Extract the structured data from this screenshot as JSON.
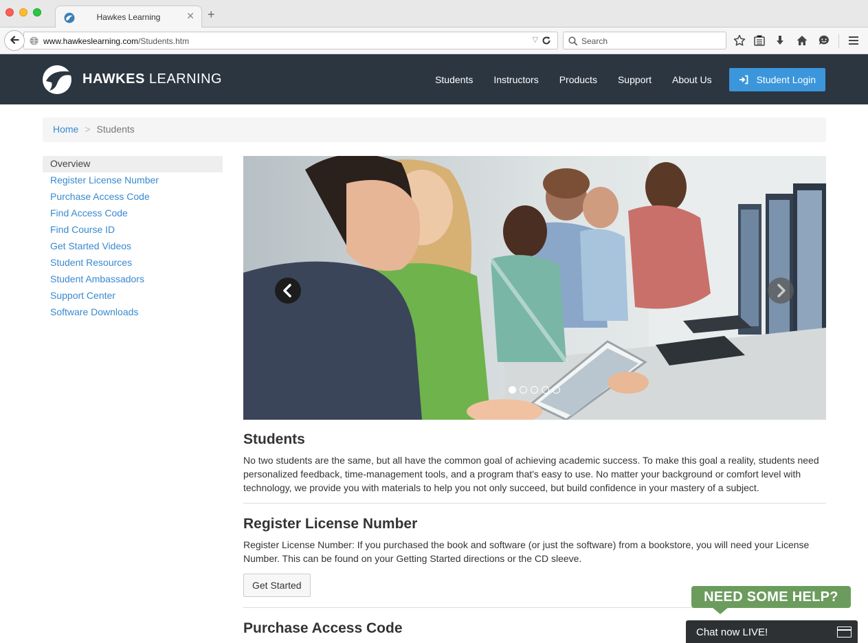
{
  "browser": {
    "tab_title": "Hawkes Learning",
    "url_host": "www.hawkeslearning.com",
    "url_path": "/Students.htm",
    "search_placeholder": "Search"
  },
  "site": {
    "logo_bold": "HAWKES",
    "logo_light": "LEARNING",
    "nav": [
      "Students",
      "Instructors",
      "Products",
      "Support",
      "About Us"
    ],
    "login_label": "Student Login"
  },
  "breadcrumb": {
    "home": "Home",
    "separator": ">",
    "current": "Students"
  },
  "sidebar": {
    "items": [
      "Overview",
      "Register License Number",
      "Purchase Access Code",
      "Find Access Code",
      "Find Course ID",
      "Get Started Videos",
      "Student Resources",
      "Student Ambassadors",
      "Support Center",
      "Software Downloads"
    ]
  },
  "carousel": {
    "slide_count": 5,
    "active_index": 0
  },
  "sections": [
    {
      "heading": "Students",
      "body": "No two students are the same, but all have the common goal of achieving academic success. To make this goal a reality, students need personalized feedback, time-management tools, and a program that's easy to use. No matter your background or comfort level with technology, we provide you with materials to help you not only succeed, but build confidence in your mastery of a subject."
    },
    {
      "heading": "Register License Number",
      "body": "Register License Number: If you purchased the book and software (or just the software) from a bookstore, you will need your License Number. This can be found on your Getting Started directions or the CD sleeve.",
      "button": "Get Started"
    },
    {
      "heading": "Purchase Access Code"
    }
  ],
  "chat": {
    "help_label": "NEED SOME HELP?",
    "chat_label": "Chat now LIVE!"
  },
  "colors": {
    "header_bg": "#2c3641",
    "accent": "#3b96db",
    "link": "#3789cf",
    "help_green": "#6b9c5d"
  }
}
